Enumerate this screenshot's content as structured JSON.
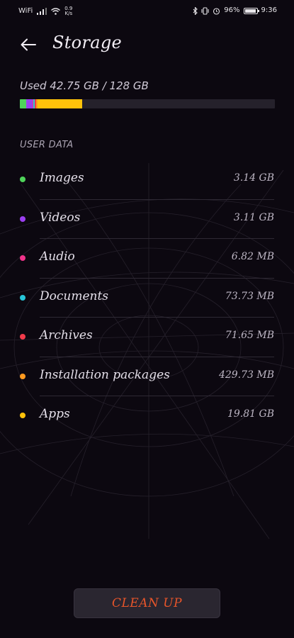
{
  "status_bar": {
    "wifi_label": "WiFi",
    "net_speed": "0.9",
    "net_unit": "K/s",
    "battery_percent": "96%",
    "battery_level": 0.96,
    "time": "9:36"
  },
  "header": {
    "title": "Storage"
  },
  "usage": {
    "text": "Used 42.75 GB / 128 GB",
    "used_fraction": 0.334
  },
  "section": {
    "label": "USER DATA"
  },
  "categories": [
    {
      "name": "Images",
      "size": "3.14 GB",
      "color": "#4fd35a",
      "share": 0.0245
    },
    {
      "name": "Videos",
      "size": "3.11 GB",
      "color": "#9b3ff0",
      "share": 0.0243
    },
    {
      "name": "Audio",
      "size": "6.82 MB",
      "color": "#f0338a",
      "share": 0.004
    },
    {
      "name": "Documents",
      "size": "73.73 MB",
      "color": "#27c6d9",
      "share": 0.006
    },
    {
      "name": "Archives",
      "size": "71.65 MB",
      "color": "#f23b4b",
      "share": 0.006
    },
    {
      "name": "Installation packages",
      "size": "429.73 MB",
      "color": "#ff9a1f",
      "share": 0.006
    },
    {
      "name": "Apps",
      "size": "19.81 GB",
      "color": "#ffc20a",
      "share": 0.175
    }
  ],
  "actions": {
    "clean_up_label": "CLEAN UP"
  },
  "colors": {
    "background": "#0c0810",
    "accent": "#e8552a",
    "bar_track": "#25212b"
  }
}
